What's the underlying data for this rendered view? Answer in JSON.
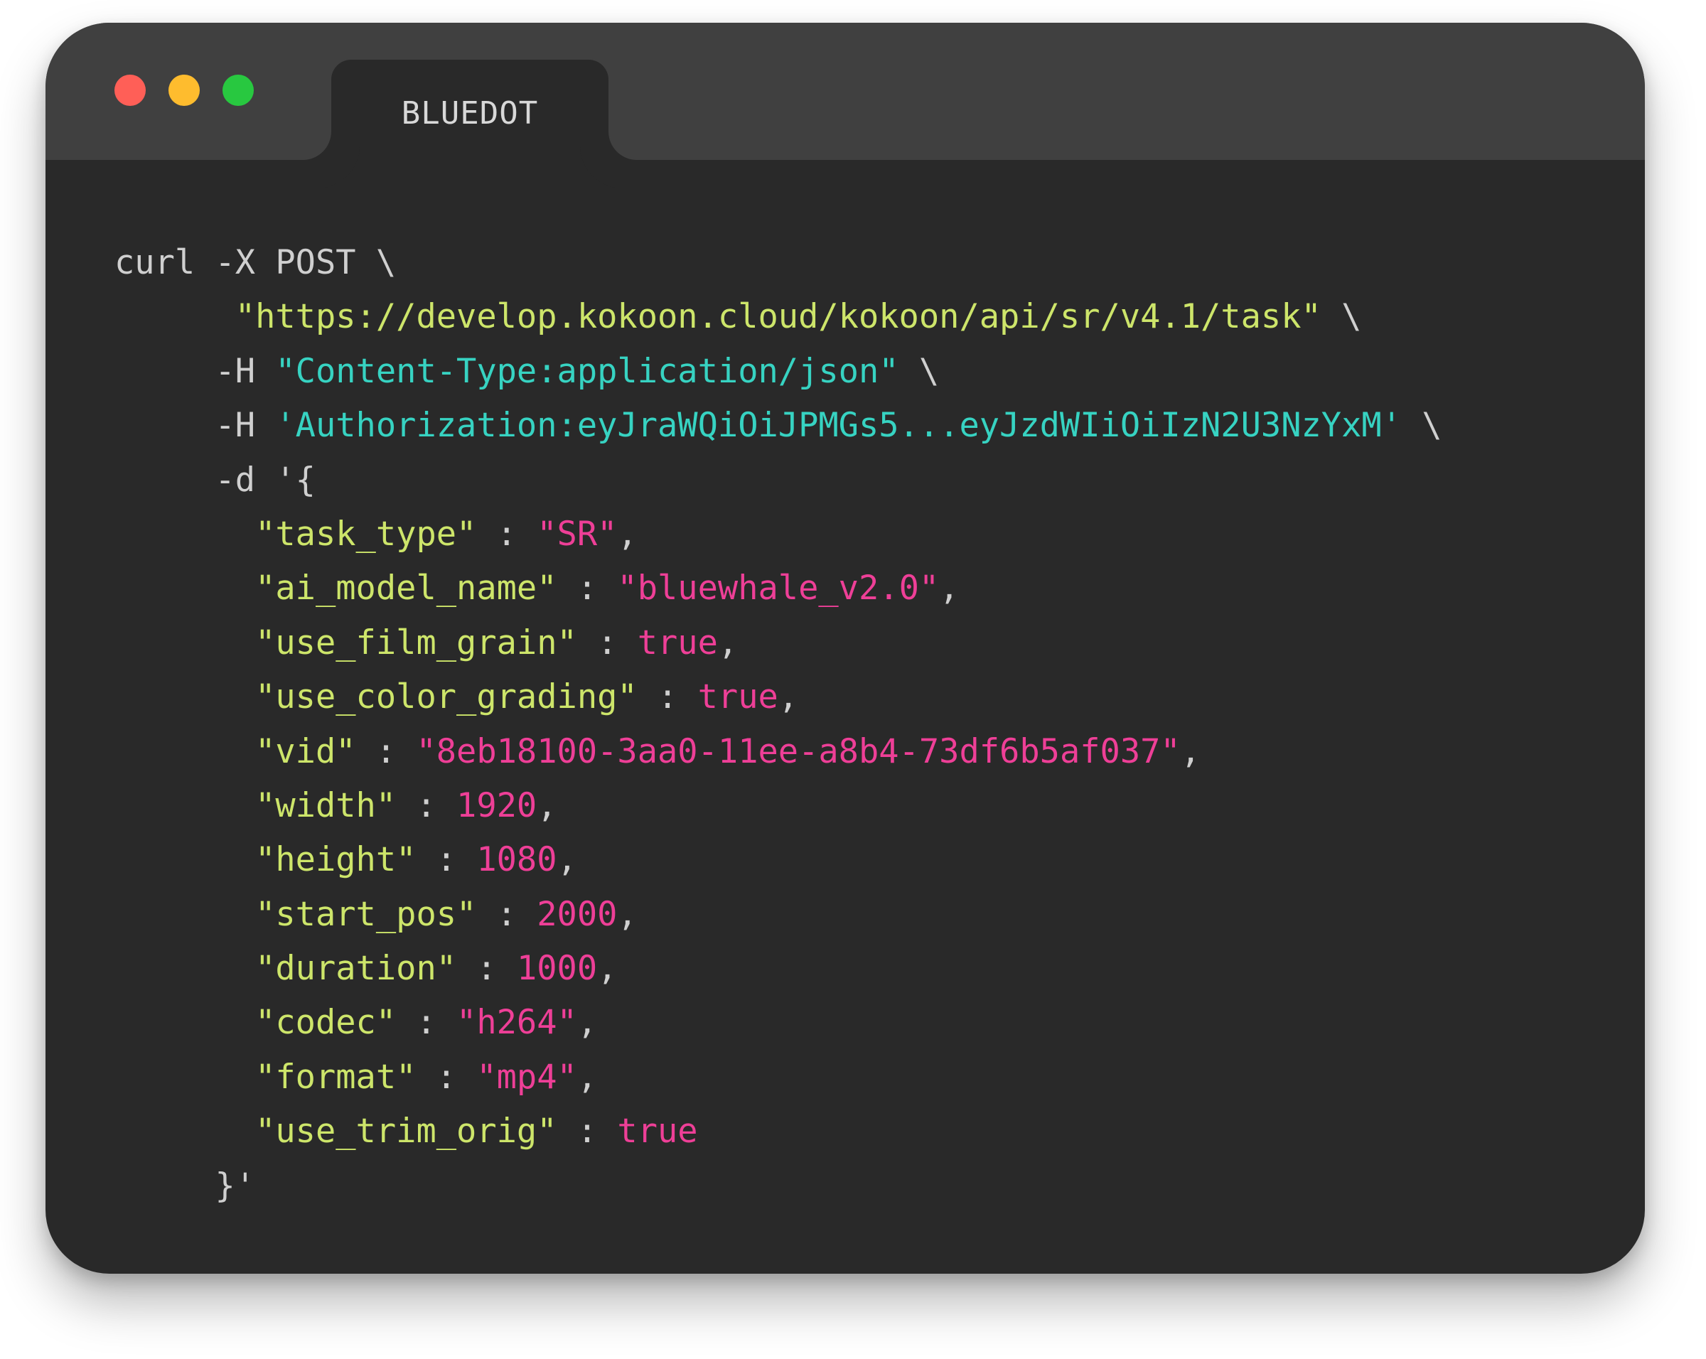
{
  "window": {
    "tab_title": "BLUEDOT",
    "controls": {
      "close_color": "#ff5f57",
      "minimize_color": "#febc2e",
      "maximize_color": "#28c840"
    }
  },
  "code": {
    "line1": "curl -X POST \\",
    "url": "\"https://develop.kokoon.cloud/kokoon/api/sr/v4.1/task\"",
    "url_tail": " \\",
    "h1_flag": "-H ",
    "h1_value": "\"Content-Type:application/json\"",
    "h1_tail": " \\",
    "h2_flag": "-H ",
    "h2_value": "'Authorization:eyJraWQiOiJPMGs5...eyJzdWIiOiIzN2U3NzYxM'",
    "h2_tail": " \\",
    "d_open": "-d '{",
    "fields": [
      {
        "key": "\"task_type\"",
        "sep": " : ",
        "value": "\"SR\"",
        "tail": ","
      },
      {
        "key": "\"ai_model_name\"",
        "sep": " : ",
        "value": "\"bluewhale_v2.0\"",
        "tail": ","
      },
      {
        "key": "\"use_film_grain\"",
        "sep": " : ",
        "value": "true",
        "tail": ","
      },
      {
        "key": "\"use_color_grading\"",
        "sep": " : ",
        "value": "true",
        "tail": ","
      },
      {
        "key": "\"vid\"",
        "sep": " : ",
        "value": "\"8eb18100-3aa0-11ee-a8b4-73df6b5af037\"",
        "tail": ","
      },
      {
        "key": "\"width\"",
        "sep": " : ",
        "value": "1920",
        "tail": ","
      },
      {
        "key": "\"height\"",
        "sep": " : ",
        "value": "1080",
        "tail": ","
      },
      {
        "key": "\"start_pos\"",
        "sep": " : ",
        "value": "2000",
        "tail": ","
      },
      {
        "key": "\"duration\"",
        "sep": " : ",
        "value": "1000",
        "tail": ","
      },
      {
        "key": "\"codec\"",
        "sep": " : ",
        "value": "\"h264\"",
        "tail": ","
      },
      {
        "key": "\"format\"",
        "sep": " : ",
        "value": "\"mp4\"",
        "tail": ","
      },
      {
        "key": "\"use_trim_orig\"",
        "sep": " : ",
        "value": "true",
        "tail": ""
      }
    ],
    "d_close": "}'"
  }
}
